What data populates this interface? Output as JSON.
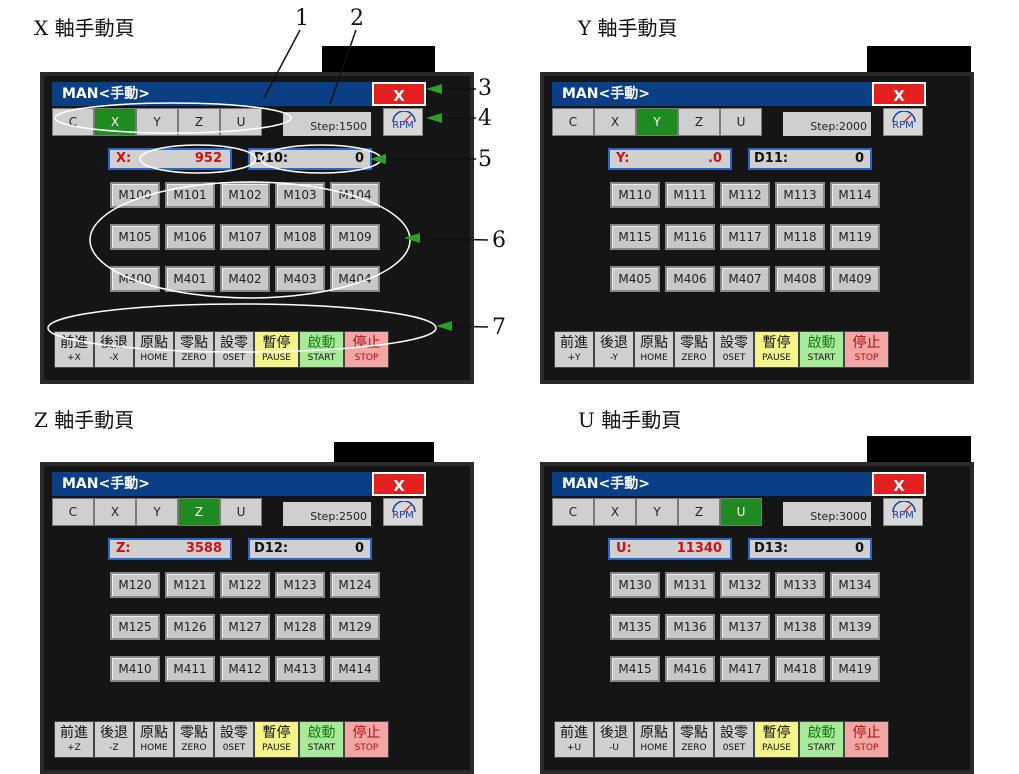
{
  "captions": [
    "X 軸手動頁",
    "Y 軸手動頁",
    "Z 軸手動頁",
    "U 軸手動頁"
  ],
  "title": "MAN<手動>",
  "close_label": "X",
  "tabs": [
    "C",
    "X",
    "Y",
    "Z",
    "U"
  ],
  "rpm_label": "RPM",
  "panels": [
    {
      "axis": "X",
      "active_tab": "X",
      "step": "Step:1500",
      "axis_label": "X:",
      "axis_value": "952",
      "d_label": "D10:",
      "d_value": "0",
      "mbuttons": [
        "M100",
        "M101",
        "M102",
        "M103",
        "M104",
        "M105",
        "M106",
        "M107",
        "M108",
        "M109",
        "M400",
        "M401",
        "M402",
        "M403",
        "M404"
      ],
      "forward_sub": "+X",
      "backward_sub": "-X"
    },
    {
      "axis": "Y",
      "active_tab": "Y",
      "step": "Step:2000",
      "axis_label": "Y:",
      "axis_value": ".0",
      "d_label": "D11:",
      "d_value": "0",
      "mbuttons": [
        "M110",
        "M111",
        "M112",
        "M113",
        "M114",
        "M115",
        "M116",
        "M117",
        "M118",
        "M119",
        "M405",
        "M406",
        "M407",
        "M408",
        "M409"
      ],
      "forward_sub": "+Y",
      "backward_sub": "-Y"
    },
    {
      "axis": "Z",
      "active_tab": "Z",
      "step": "Step:2500",
      "axis_label": "Z:",
      "axis_value": "3588",
      "d_label": "D12:",
      "d_value": "0",
      "mbuttons": [
        "M120",
        "M121",
        "M122",
        "M123",
        "M124",
        "M125",
        "M126",
        "M127",
        "M128",
        "M129",
        "M410",
        "M411",
        "M412",
        "M413",
        "M414"
      ],
      "forward_sub": "+Z",
      "backward_sub": "-Z"
    },
    {
      "axis": "U",
      "active_tab": "U",
      "step": "Step:3000",
      "axis_label": "U:",
      "axis_value": "11340",
      "d_label": "D13:",
      "d_value": "0",
      "mbuttons": [
        "M130",
        "M131",
        "M132",
        "M133",
        "M134",
        "M135",
        "M136",
        "M137",
        "M138",
        "M139",
        "M415",
        "M416",
        "M417",
        "M418",
        "M419"
      ],
      "forward_sub": "+U",
      "backward_sub": "-U"
    }
  ],
  "controls": {
    "forward_zh": "前進",
    "backward_zh": "後退",
    "home_zh": "原點",
    "home_en": "HOME",
    "zero_zh": "零點",
    "zero_en": "ZERO",
    "set_zh": "設零",
    "set_en": "0SET",
    "pause_zh": "暫停",
    "pause_en": "PAUSE",
    "start_zh": "啟動",
    "start_en": "START",
    "stop_zh": "停止",
    "stop_en": "STOP"
  },
  "annotations": [
    "1",
    "2",
    "3",
    "4",
    "5",
    "6",
    "7"
  ],
  "colors": {
    "title_bar": "#0a3f86",
    "close": "#e32020",
    "active_tab": "#1f8a1f",
    "value_text": "#d01010"
  }
}
